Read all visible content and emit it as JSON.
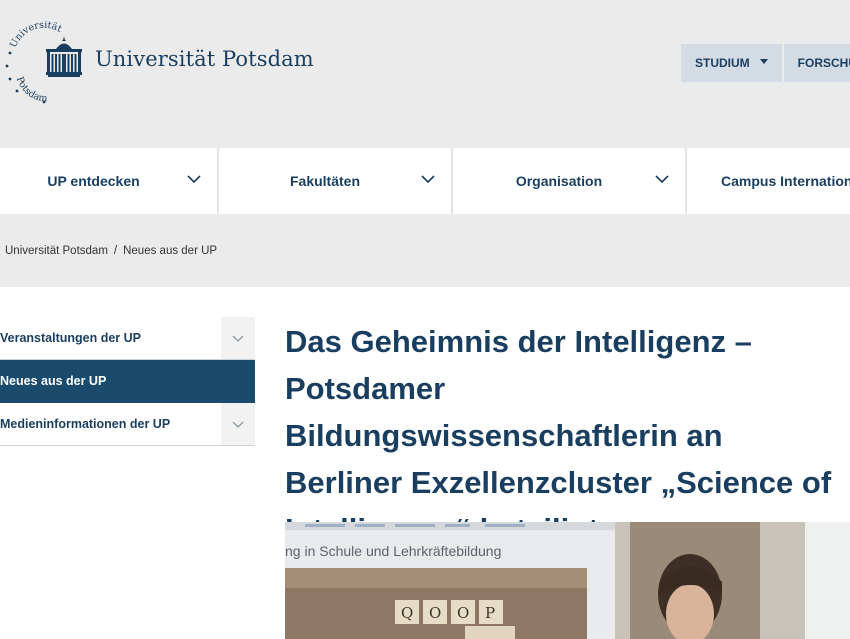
{
  "header": {
    "seal_text_top": "Universität",
    "seal_text_bottom": "Potsdam",
    "logo_text": "Universität Potsdam",
    "topnav": [
      {
        "label": "STUDIUM",
        "has_dropdown": true
      },
      {
        "label": "FORSCHU",
        "has_dropdown": false
      }
    ]
  },
  "mainnav": {
    "items": [
      {
        "label": "UP entdecken"
      },
      {
        "label": "Fakultäten"
      },
      {
        "label": "Organisation"
      },
      {
        "label": "Campus Internation"
      }
    ]
  },
  "breadcrumb": {
    "items": [
      "Universität Potsdam",
      "Neues aus der UP"
    ],
    "separator": "/"
  },
  "sidenav": {
    "items": [
      {
        "label": "Veranstaltungen der UP",
        "active": false,
        "expandable": true
      },
      {
        "label": "Neues aus der UP",
        "active": true,
        "expandable": false
      },
      {
        "label": "Medieninformationen der UP",
        "active": false,
        "expandable": true
      }
    ]
  },
  "article": {
    "headline": "Das Geheimnis der Intelligenz – Potsdamer Bildungswissenschaftlerin an Berliner Exzellenzcluster „Science of Intelligence“ beteiligt",
    "image_screen_text": "ng in Schule und Lehrkräftebildung",
    "image_tiles": [
      "Q",
      "O",
      "O",
      "P"
    ]
  },
  "colors": {
    "brand": "#193e5f",
    "active_nav": "#1b4b6c",
    "header_bg": "#ebebeb",
    "topnav_bg": "#d3dce5"
  }
}
